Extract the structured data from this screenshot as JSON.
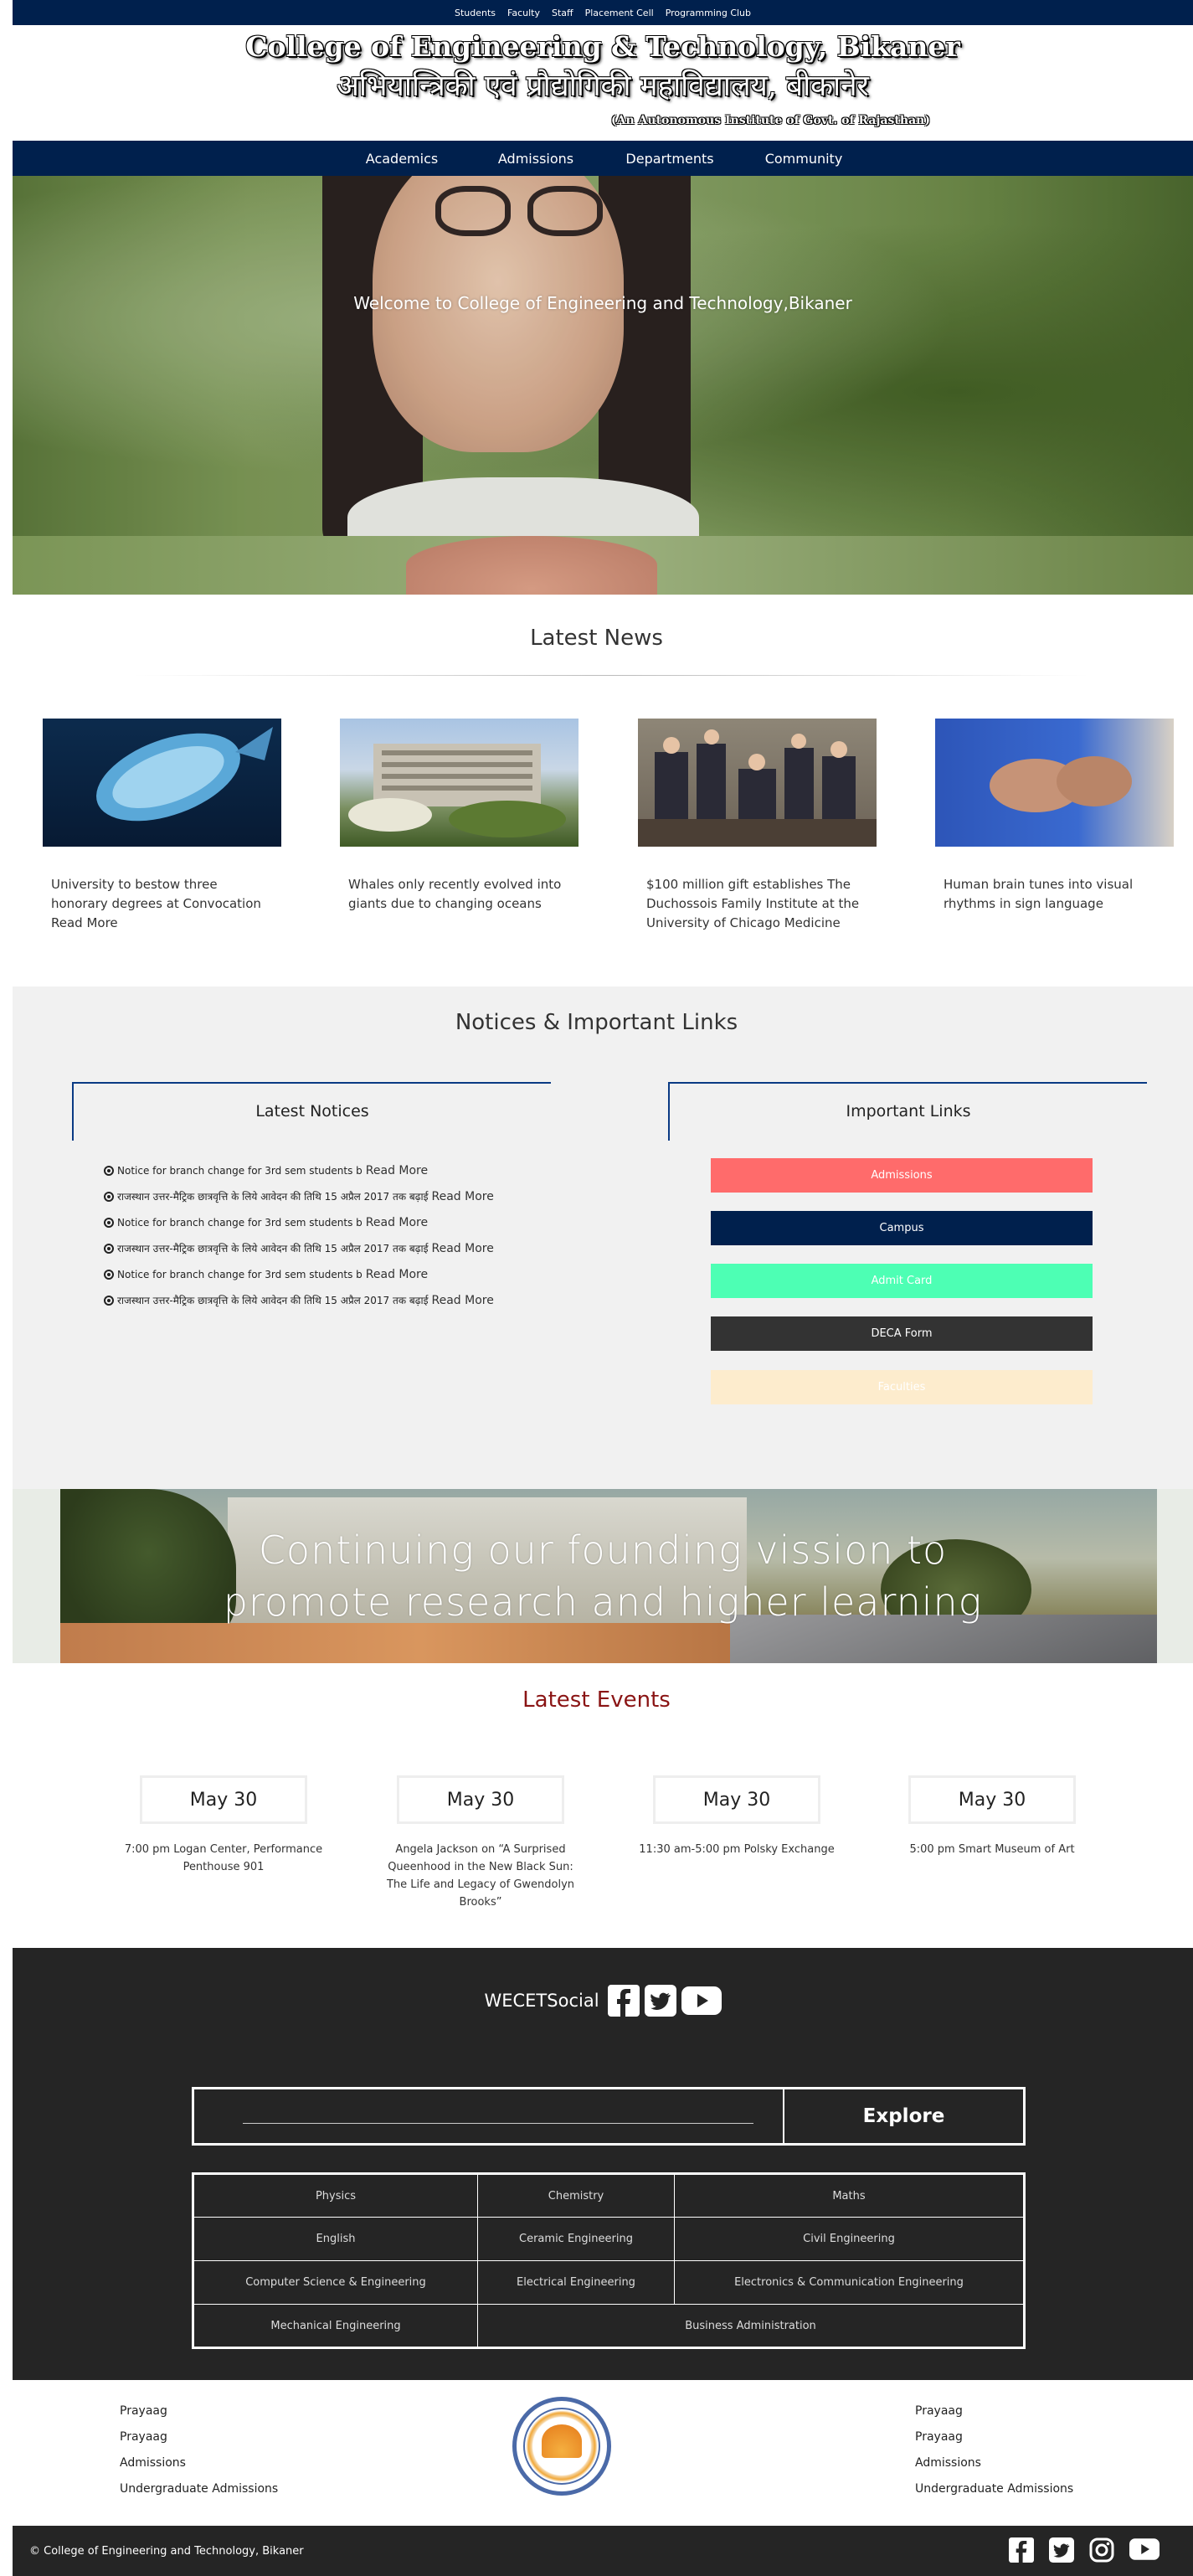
{
  "topbar": {
    "items": [
      "Students",
      "Faculty",
      "Staff",
      "Placement Cell",
      "Programming Club"
    ]
  },
  "header": {
    "title_en": "College of Engineering & Technology, Bikaner",
    "title_hi": "अभियान्त्रिकी एवं प्रौद्योगिकी महाविद्यालय, बीकानेर",
    "subtitle": "(An Autonomous Institute of Govt. of Rajasthan)"
  },
  "nav": {
    "items": [
      "Academics",
      "Admissions",
      "Departments",
      "Community"
    ]
  },
  "hero": {
    "text": "Welcome to College of Engineering and Technology,Bikaner"
  },
  "news": {
    "title": "Latest News",
    "items": [
      {
        "text": "University to bestow three honorary degrees at Convocation",
        "more": "Read More"
      },
      {
        "text": "Whales only recently evolved into giants due to changing oceans"
      },
      {
        "text": "$100 million gift establishes The Duchossois Family Institute at the University of Chicago Medicine"
      },
      {
        "text": "Human brain tunes into visual rhythms in sign language"
      }
    ]
  },
  "notices": {
    "title": "Notices & Important Links",
    "latest_title": "Latest Notices",
    "links_title": "Important Links",
    "items": [
      {
        "text": "Notice for branch change for 3rd sem students b",
        "more": "Read More"
      },
      {
        "text": "राजस्थान उत्तर-मैट्रिक छात्रवृत्ति के लिये आवेदन की तिथि 15 अप्रैल 2017 तक बढ़ाई",
        "more": "Read More"
      },
      {
        "text": "Notice for branch change for 3rd sem students b",
        "more": "Read More"
      },
      {
        "text": "राजस्थान उत्तर-मैट्रिक छात्रवृत्ति के लिये आवेदन की तिथि 15 अप्रैल 2017 तक बढ़ाई",
        "more": "Read More"
      },
      {
        "text": "Notice for branch change for 3rd sem students b",
        "more": "Read More"
      },
      {
        "text": "राजस्थान उत्तर-मैट्रिक छात्रवृत्ति के लिये आवेदन की तिथि 15 अप्रैल 2017 तक बढ़ाई",
        "more": "Read More"
      }
    ],
    "links": [
      {
        "label": "Admissions",
        "color": "#ff6b6b"
      },
      {
        "label": "Campus",
        "color": "#00204d"
      },
      {
        "label": "Admit Card",
        "color": "#4dffb4"
      },
      {
        "label": "DECA Form",
        "color": "#333333"
      },
      {
        "label": "Faculties",
        "color": "#fdeccd"
      }
    ]
  },
  "banner": {
    "line1": "Continuing our founding vission to",
    "line2": "promote research and higher learning"
  },
  "events": {
    "title": "Latest Events",
    "items": [
      {
        "date": "May 30",
        "desc": "7:00 pm Logan Center, Performance Penthouse 901"
      },
      {
        "date": "May 30",
        "desc": "Angela Jackson on “A Surprised Queenhood in the New Black Sun: The Life and Legacy of Gwendolyn Brooks”"
      },
      {
        "date": "May 30",
        "desc": "11:30 am-5:00 pm Polsky Exchange"
      },
      {
        "date": "May 30",
        "desc": "5:00 pm Smart Museum of Art"
      }
    ]
  },
  "footer": {
    "social_label": "WECETSocial",
    "search_placeholder": "",
    "explore": "Explore",
    "departments": [
      [
        "Physics",
        "Chemistry",
        "Maths"
      ],
      [
        "English",
        "Ceramic Engineering",
        "Civil Engineering"
      ],
      [
        "Computer Science & Engineering",
        "Electrical Engineering",
        "Electronics & Communication Engineering"
      ],
      [
        "Mechanical Engineering",
        "Business Administration"
      ]
    ],
    "left_links": [
      "Prayaag",
      "Prayaag",
      "Admissions",
      "Undergraduate Admissions"
    ],
    "right_links": [
      "Prayaag",
      "Prayaag",
      "Admissions",
      "Undergraduate Admissions"
    ],
    "copyright": "© College of Engineering and Technology, Bikaner"
  }
}
